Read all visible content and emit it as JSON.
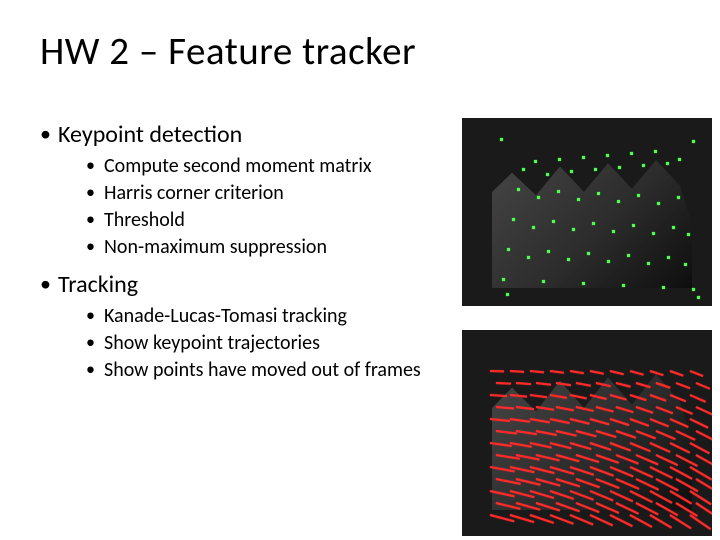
{
  "title": "HW 2 – Feature tracker",
  "bullets": {
    "b1": "Keypoint detection",
    "b1_items": {
      "i1": "Compute second moment matrix",
      "i2": "Harris corner criterion",
      "i3": "Threshold",
      "i4": "Non-maximum suppression"
    },
    "b2": "Tracking",
    "b2_items": {
      "i1": "Kanade-Lucas-Tomasi tracking",
      "i2": "Show keypoint trajectories",
      "i3": "Show points have moved out of frames"
    }
  },
  "figures": {
    "top_alt": "Keypoint detection on building image (green dots)",
    "bot_alt": "KLT tracking trajectories (red streaks)"
  }
}
